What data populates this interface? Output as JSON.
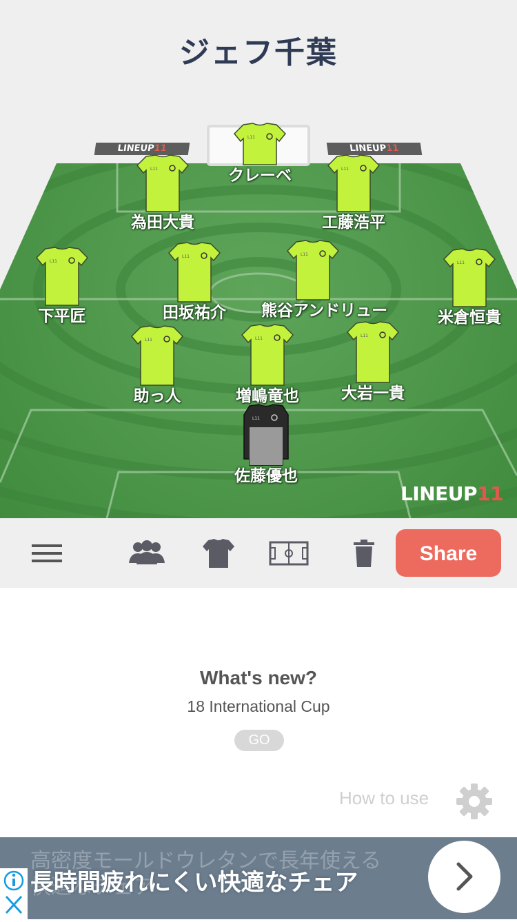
{
  "team_name": "ジェフ千葉",
  "brand": {
    "left": "LINEUP",
    "right": "11"
  },
  "players": [
    {
      "name": "クレーベ",
      "kit": "outfield"
    },
    {
      "name": "為田大貴",
      "kit": "outfield"
    },
    {
      "name": "工藤浩平",
      "kit": "outfield"
    },
    {
      "name": "下平匠",
      "kit": "outfield"
    },
    {
      "name": "田坂祐介",
      "kit": "outfield"
    },
    {
      "name": "熊谷アンドリュー",
      "kit": "outfield"
    },
    {
      "name": "米倉恒貴",
      "kit": "outfield"
    },
    {
      "name": "助っ人",
      "kit": "outfield"
    },
    {
      "name": "増嶋竜也",
      "kit": "outfield"
    },
    {
      "name": "大岩一貴",
      "kit": "outfield"
    },
    {
      "name": "佐藤優也",
      "kit": "goalkeeper"
    }
  ],
  "toolbar": {
    "menu_icon": "hamburger-menu-icon",
    "players_icon": "people-icon",
    "kit_icon": "shirt-icon",
    "formation_icon": "pitch-icon",
    "delete_icon": "trash-icon",
    "share_label": "Share"
  },
  "news": {
    "title": "What's new?",
    "subtitle": "18 International Cup",
    "go_label": "GO"
  },
  "how_to_use": "How to use",
  "ad": {
    "background_text_1": "高密度モールドウレタンで長年使える",
    "background_text_2": "快適なチェア",
    "headline": "長時間疲れにくい快適なチェア"
  },
  "colors": {
    "kit": "#c3f23d",
    "keeper_kit": "#9a9a9a",
    "pitch": "#4a8f47",
    "share": "#ed6a5e",
    "title": "#2f3a55",
    "ad_bg": "#6c7d8e"
  }
}
